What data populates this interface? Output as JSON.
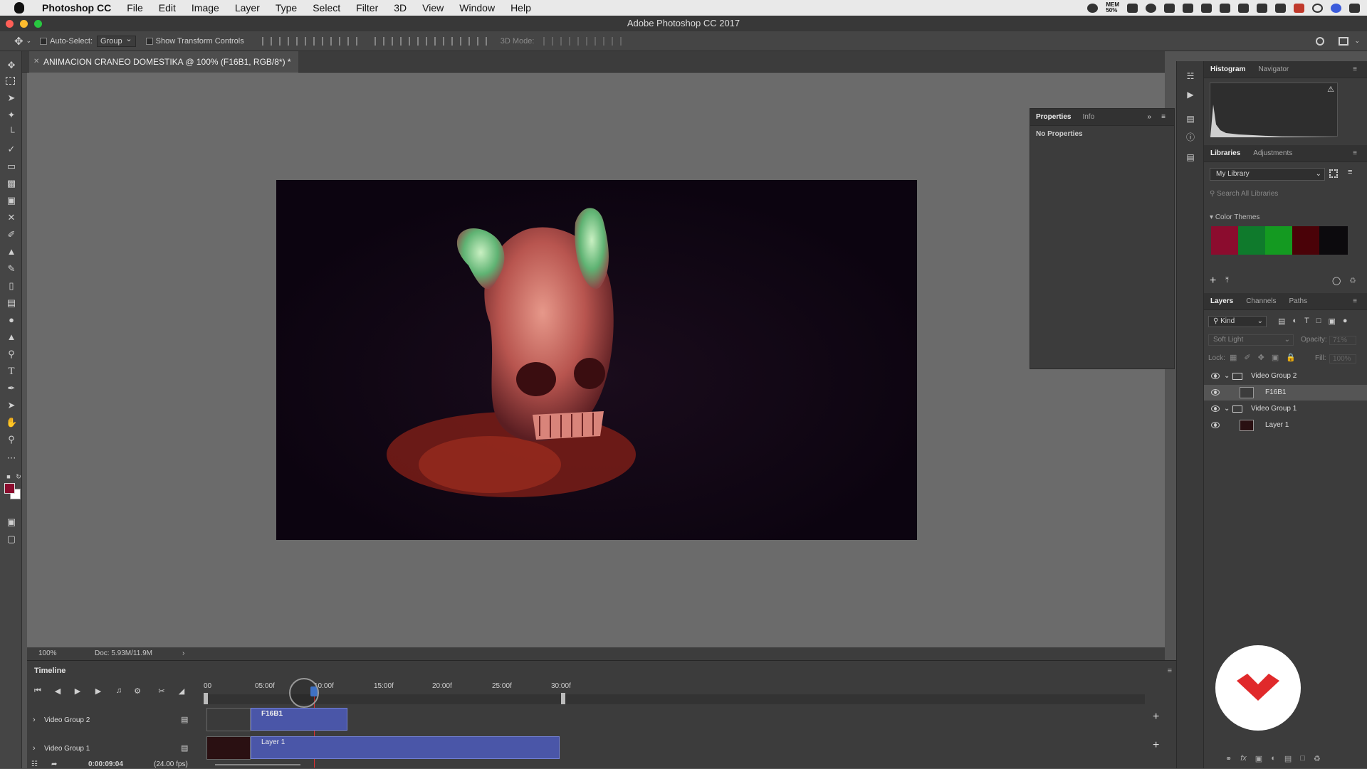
{
  "menubar": {
    "app_name": "Photoshop CC",
    "items": [
      "File",
      "Edit",
      "Image",
      "Layer",
      "Type",
      "Select",
      "Filter",
      "3D",
      "View",
      "Window",
      "Help"
    ],
    "mem_label": "MEM",
    "mem_value": "50%"
  },
  "window": {
    "title": "Adobe Photoshop CC 2017"
  },
  "options": {
    "auto_select_label": "Auto-Select:",
    "auto_select_value": "Group",
    "transform_label": "Show Transform Controls",
    "mode_3d_label": "3D Mode:"
  },
  "document": {
    "tab_title": "ANIMACION CRANEO DOMESTIKA @ 100% (F16B1, RGB/8*) *",
    "zoom": "100%",
    "doc_size": "Doc: 5.93M/11.9M"
  },
  "timeline": {
    "title": "Timeline",
    "ruler": [
      "00",
      "05:00f",
      "10:00f",
      "15:00f",
      "20:00f",
      "25:00f",
      "30:00f"
    ],
    "tracks": [
      {
        "name": "Video Group 2",
        "clip": "F16B1"
      },
      {
        "name": "Video Group 1",
        "clip": "Layer 1"
      }
    ],
    "current_time": "0:00:09:04",
    "fps": "(24.00 fps)"
  },
  "properties": {
    "tabs": [
      "Properties",
      "Info"
    ],
    "body": "No Properties"
  },
  "histogram": {
    "tabs": [
      "Histogram",
      "Navigator"
    ]
  },
  "libraries": {
    "tabs": [
      "Libraries",
      "Adjustments"
    ],
    "selected_library": "My Library",
    "search_placeholder": "Search All Libraries",
    "section": "Color Themes",
    "colors": [
      "#8b0c2e",
      "#0f7a2c",
      "#149a21",
      "#4a0208",
      "#0c0a0d"
    ]
  },
  "layers": {
    "tabs": [
      "Layers",
      "Channels",
      "Paths"
    ],
    "kind_label": "Kind",
    "blend_mode": "Soft Light",
    "opacity_label": "Opacity:",
    "opacity_value": "71%",
    "lock_label": "Lock:",
    "fill_label": "Fill:",
    "fill_value": "100%",
    "items": [
      {
        "name": "Video Group 2",
        "type": "group"
      },
      {
        "name": "F16B1",
        "type": "layer"
      },
      {
        "name": "Video Group 1",
        "type": "group"
      },
      {
        "name": "Layer 1",
        "type": "layer"
      }
    ]
  }
}
